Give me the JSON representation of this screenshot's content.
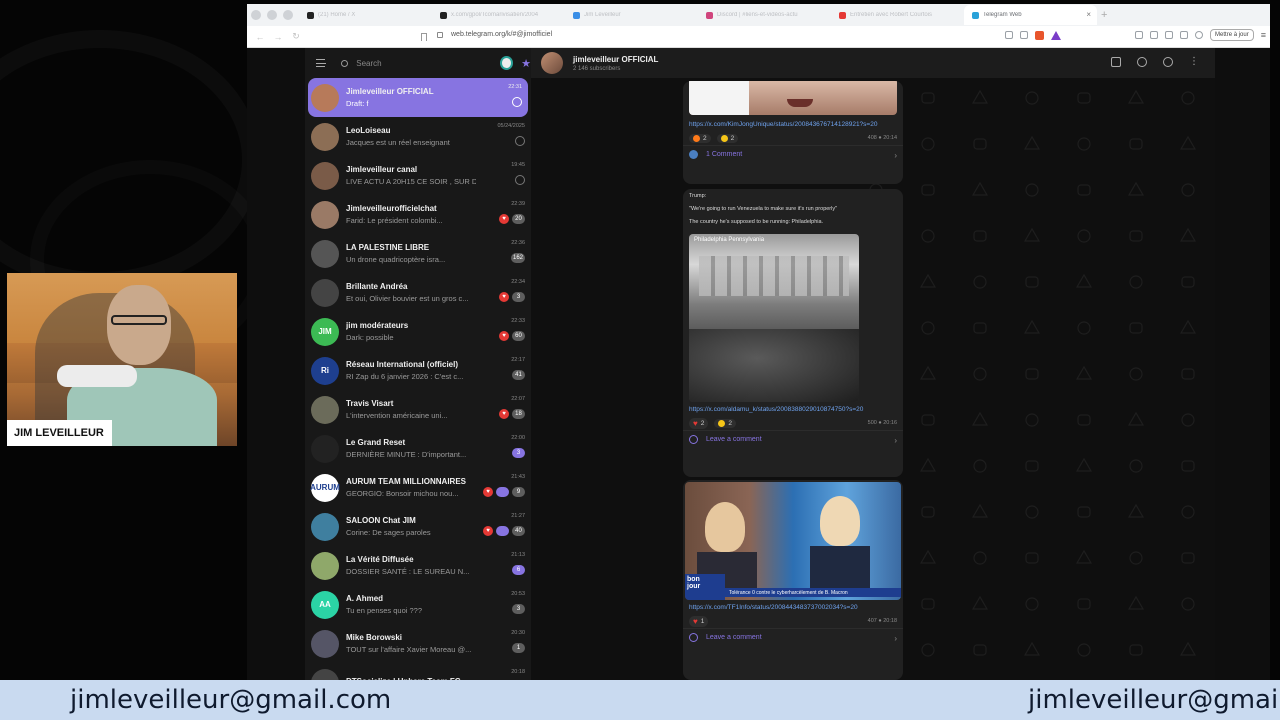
{
  "browser": {
    "tabs": [
      {
        "label": "(21) Home / X",
        "fav": "#222"
      },
      {
        "label": "x.com/gpol/Tcomarivisatien/2004",
        "fav": "#222"
      },
      {
        "label": "Jim Leveilleur",
        "fav": "#3a8ee6"
      },
      {
        "label": "Discord | #liens-et-vidéos-actu",
        "fav": "#d0457d"
      },
      {
        "label": "Entretien avec Robert Courtois",
        "fav": "#e53935"
      },
      {
        "label": "Telegram Web",
        "fav": "#2aa2d9",
        "active": true
      }
    ],
    "url": "web.telegram.org/k/#@jimofficiel",
    "update_label": "Mettre à jour"
  },
  "telegram": {
    "search_placeholder": "Search",
    "chats": [
      {
        "name": "Jimleveilleur OFFICIAL",
        "preview": "Draft: f",
        "time": "22:31",
        "active": true,
        "avatar": "#b77a5a",
        "badges": []
      },
      {
        "name": "LeoLoiseau",
        "preview": "Jacques est un réel enseignant",
        "time": "05/24/2025",
        "avatar": "#8c6e55",
        "badges": []
      },
      {
        "name": "Jimleveilleur canal",
        "preview": "LIVE ACTU A 20H15 CE SOIR , SUR D...",
        "time": "19:45",
        "avatar": "#7a5b48",
        "badges": []
      },
      {
        "name": "Jimleveilleurofficielchat",
        "preview": "Farid: Le président colombi...",
        "time": "22:39",
        "avatar": "#9a7a66",
        "badges": [
          "heart",
          "20"
        ]
      },
      {
        "name": "LA PALESTINE LIBRE",
        "preview": "Un drone quadricoptère isra...",
        "time": "22:36",
        "avatar": "#555",
        "badges": [
          "162"
        ]
      },
      {
        "name": "Brillante Andréa",
        "preview": "Et oui, Olivier bouvier est un gros c...",
        "time": "22:34",
        "avatar": "#444",
        "badges": [
          "heart",
          "3"
        ]
      },
      {
        "name": "jim modérateurs",
        "preview": "Dark: possible",
        "time": "22:33",
        "avatar": "#3cba54",
        "initials": "JIM",
        "badges": [
          "heart",
          "60"
        ]
      },
      {
        "name": "Réseau International (officiel)",
        "preview": "RI Zap du 6 janvier 2026 : C'est c...",
        "time": "22:17",
        "avatar": "#1e3f8f",
        "initials": "Ri",
        "badges": [
          "41"
        ]
      },
      {
        "name": "Travis Visart",
        "preview": "L'intervention américaine uni...",
        "time": "22:07",
        "avatar": "#6b6b5a",
        "badges": [
          "heart",
          "18"
        ]
      },
      {
        "name": "Le Grand Reset",
        "preview": "DERNIÈRE MINUTE : D'important...",
        "time": "22:00",
        "avatar": "#222",
        "badges": [
          "purple:3"
        ]
      },
      {
        "name": "AURUM TEAM MILLIONNAIRES",
        "preview": "GEORGIO: Bonsoir michou nou...",
        "time": "21:43",
        "avatar": "#fff",
        "initials": "AURUM",
        "badges": [
          "heart",
          "purple:",
          "9"
        ]
      },
      {
        "name": "SALOON Chat JIM",
        "preview": "Corine: De sages paroles",
        "time": "21:27",
        "avatar": "#3f7f9f",
        "badges": [
          "heart",
          "purple:",
          "40"
        ]
      },
      {
        "name": "La Vérité Diffusée",
        "preview": "DOSSIER SANTÉ : LE SUREAU N...",
        "time": "21:13",
        "avatar": "#8fa86a",
        "badges": [
          "purple:6"
        ]
      },
      {
        "name": "A. Ahmed",
        "preview": "Tu en penses quoi ???",
        "time": "20:53",
        "avatar": "#2bd3a5",
        "initials": "AA",
        "badges": [
          "3"
        ]
      },
      {
        "name": "Mike Borowski",
        "preview": "TOUT sur l'affaire Xavier Moreau @...",
        "time": "20:30",
        "avatar": "#556",
        "badges": [
          "1"
        ]
      },
      {
        "name": "DTSocialize | Upbare Team FC",
        "preview": "",
        "time": "20:18",
        "avatar": "#444",
        "badges": []
      }
    ],
    "channel": {
      "title": "jimleveilleur OFFICIAL",
      "subtitle": "2 146 subscribers"
    },
    "posts": [
      {
        "link": "https://x.com/KimJongUnique/status/200843676714128921?s=20",
        "reactions": [
          {
            "icon": "fire",
            "count": "2"
          },
          {
            "icon": "smile",
            "count": "2"
          }
        ],
        "views": "408",
        "time": "20:14",
        "comment": "1 Comment"
      },
      {
        "text_lines": [
          "Trump:",
          "\"We're going to run Venezuela to make sure it's run properly\"",
          "The country he's supposed to be running: Philadelphia."
        ],
        "photo_caption": "Philadelphia Pennsylvania",
        "link": "https://x.com/aldamu_k/status/2008388029010874750?s=20",
        "reactions": [
          {
            "icon": "heart",
            "count": "2"
          },
          {
            "icon": "scream",
            "count": "2"
          }
        ],
        "views": "500",
        "time": "20:16",
        "comment": "Leave a comment"
      },
      {
        "photo_caption": "Tolérance 0 contre le cyberharcèlement de B. Macron",
        "link": "https://x.com/TF1Info/status/2008443483737002034?s=20",
        "reactions": [
          {
            "icon": "heart",
            "count": "1"
          }
        ],
        "views": "407",
        "time": "20:18",
        "comment": "Leave a comment"
      }
    ]
  },
  "overlay": {
    "streamer_name": "JIM LEVEILLEUR",
    "ticker_text": "jimleveilleur@gmail.com",
    "ticker_text_2": "jimleveilleur@gmail"
  },
  "colors": {
    "accent": "#8774e1",
    "ticker_bg": "#c9daf0",
    "link": "#6fa3ef"
  }
}
